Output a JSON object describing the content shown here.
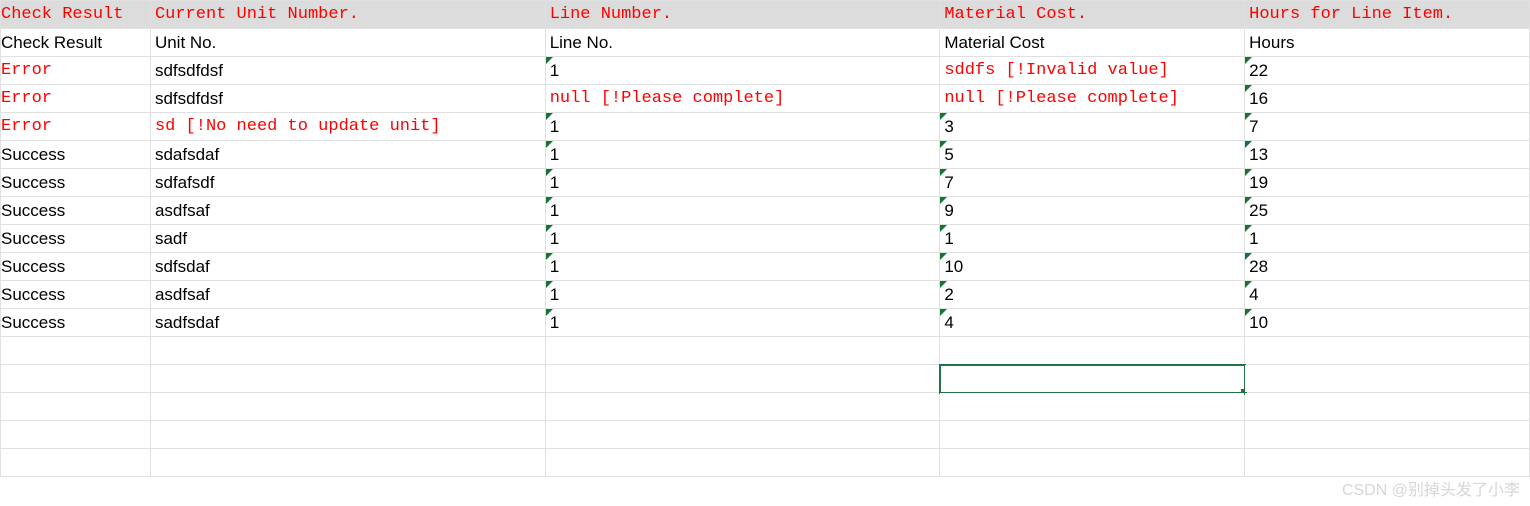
{
  "columns": {
    "header": [
      "Check Result",
      "Current Unit Number.",
      "Line Number.",
      "Material Cost.",
      "Hours for Line Item."
    ],
    "subhead": [
      "Check Result",
      "Unit No.",
      "Line No.",
      "Material Cost",
      "Hours"
    ]
  },
  "rows": [
    {
      "check": {
        "text": "Error",
        "err": true
      },
      "unit": {
        "text": "sdfsdfdsf",
        "err": false,
        "num": false
      },
      "line": {
        "text": "1",
        "err": false,
        "num": true
      },
      "cost": {
        "text": "sddfs [!Invalid value]",
        "err": true,
        "num": false
      },
      "hours": {
        "text": "22",
        "err": false,
        "num": true
      }
    },
    {
      "check": {
        "text": "Error",
        "err": true
      },
      "unit": {
        "text": "sdfsdfdsf",
        "err": false,
        "num": false
      },
      "line": {
        "text": "null [!Please complete]",
        "err": true,
        "num": false
      },
      "cost": {
        "text": "null [!Please complete]",
        "err": true,
        "num": false
      },
      "hours": {
        "text": "16",
        "err": false,
        "num": true
      }
    },
    {
      "check": {
        "text": "Error",
        "err": true
      },
      "unit": {
        "text": "sd [!No need to update unit]",
        "err": true,
        "num": false
      },
      "line": {
        "text": "1",
        "err": false,
        "num": true
      },
      "cost": {
        "text": "3",
        "err": false,
        "num": true
      },
      "hours": {
        "text": "7",
        "err": false,
        "num": true
      }
    },
    {
      "check": {
        "text": "Success",
        "err": false
      },
      "unit": {
        "text": "sdafsdaf",
        "err": false,
        "num": false
      },
      "line": {
        "text": "1",
        "err": false,
        "num": true
      },
      "cost": {
        "text": "5",
        "err": false,
        "num": true
      },
      "hours": {
        "text": "13",
        "err": false,
        "num": true
      }
    },
    {
      "check": {
        "text": "Success",
        "err": false
      },
      "unit": {
        "text": "sdfafsdf",
        "err": false,
        "num": false
      },
      "line": {
        "text": "1",
        "err": false,
        "num": true
      },
      "cost": {
        "text": "7",
        "err": false,
        "num": true
      },
      "hours": {
        "text": "19",
        "err": false,
        "num": true
      }
    },
    {
      "check": {
        "text": "Success",
        "err": false
      },
      "unit": {
        "text": "asdfsaf",
        "err": false,
        "num": false
      },
      "line": {
        "text": "1",
        "err": false,
        "num": true
      },
      "cost": {
        "text": "9",
        "err": false,
        "num": true
      },
      "hours": {
        "text": "25",
        "err": false,
        "num": true
      }
    },
    {
      "check": {
        "text": "Success",
        "err": false
      },
      "unit": {
        "text": "sadf",
        "err": false,
        "num": false
      },
      "line": {
        "text": "1",
        "err": false,
        "num": true
      },
      "cost": {
        "text": "1",
        "err": false,
        "num": true
      },
      "hours": {
        "text": "1",
        "err": false,
        "num": true
      }
    },
    {
      "check": {
        "text": "Success",
        "err": false
      },
      "unit": {
        "text": "sdfsdaf",
        "err": false,
        "num": false
      },
      "line": {
        "text": "1",
        "err": false,
        "num": true
      },
      "cost": {
        "text": "10",
        "err": false,
        "num": true
      },
      "hours": {
        "text": "28",
        "err": false,
        "num": true
      }
    },
    {
      "check": {
        "text": "Success",
        "err": false
      },
      "unit": {
        "text": "asdfsaf",
        "err": false,
        "num": false
      },
      "line": {
        "text": "1",
        "err": false,
        "num": true
      },
      "cost": {
        "text": "2",
        "err": false,
        "num": true
      },
      "hours": {
        "text": "4",
        "err": false,
        "num": true
      }
    },
    {
      "check": {
        "text": "Success",
        "err": false
      },
      "unit": {
        "text": "sadfsdaf",
        "err": false,
        "num": false
      },
      "line": {
        "text": "1",
        "err": false,
        "num": true
      },
      "cost": {
        "text": "4",
        "err": false,
        "num": true
      },
      "hours": {
        "text": "10",
        "err": false,
        "num": true
      }
    }
  ],
  "empty_rows": 5,
  "selected": {
    "row_index": 13,
    "col": 3
  },
  "watermark": "CSDN @别掉头发了小李",
  "chart_data": {
    "type": "table",
    "columns": [
      "Check Result",
      "Unit No.",
      "Line No.",
      "Material Cost",
      "Hours"
    ],
    "rows": [
      [
        "Error",
        "sdfsdfdsf",
        "1",
        "sddfs [!Invalid value]",
        "22"
      ],
      [
        "Error",
        "sdfsdfdsf",
        "null [!Please complete]",
        "null [!Please complete]",
        "16"
      ],
      [
        "Error",
        "sd [!No need to update unit]",
        "1",
        "3",
        "7"
      ],
      [
        "Success",
        "sdafsdaf",
        "1",
        "5",
        "13"
      ],
      [
        "Success",
        "sdfafsdf",
        "1",
        "7",
        "19"
      ],
      [
        "Success",
        "asdfsaf",
        "1",
        "9",
        "25"
      ],
      [
        "Success",
        "sadf",
        "1",
        "1",
        "1"
      ],
      [
        "Success",
        "sdfsdaf",
        "1",
        "10",
        "28"
      ],
      [
        "Success",
        "asdfsaf",
        "1",
        "2",
        "4"
      ],
      [
        "Success",
        "sadfsdaf",
        "1",
        "4",
        "10"
      ]
    ]
  }
}
